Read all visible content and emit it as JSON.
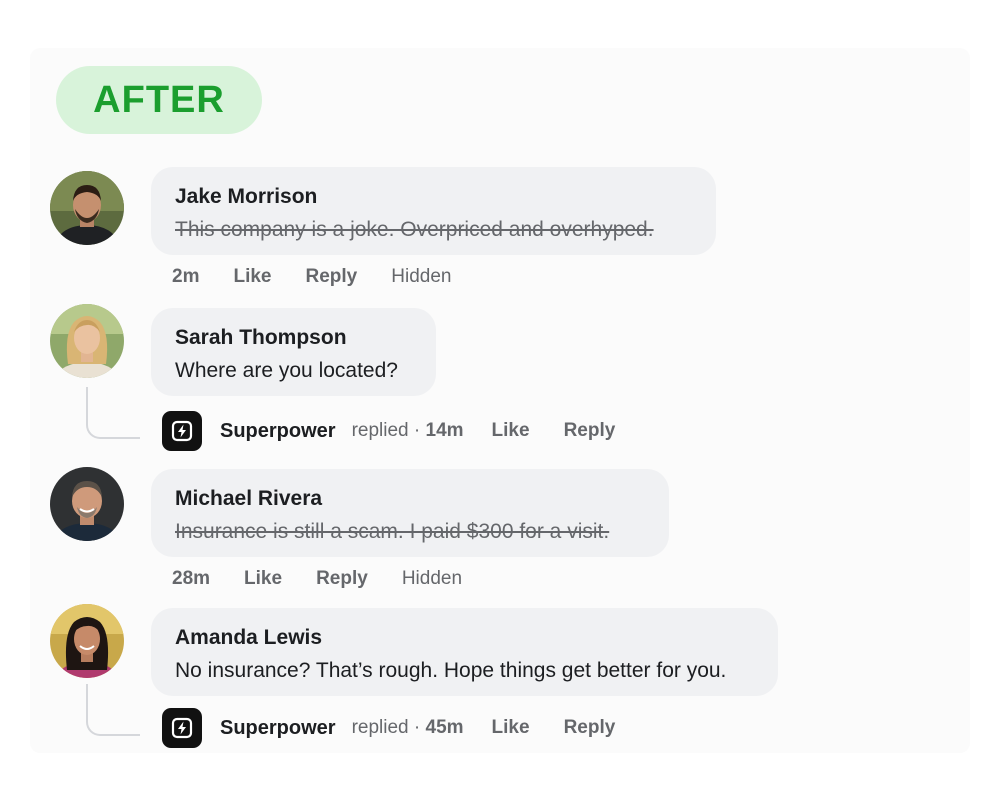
{
  "badge": {
    "label": "AFTER",
    "color": "#1b9e2e",
    "background": "#d8f3da"
  },
  "comments": [
    {
      "author": "Jake Morrison",
      "text": "This company is a joke. Overpriced and overhyped.",
      "hidden_text": true,
      "time": "2m",
      "like": "Like",
      "reply": "Reply",
      "status": "Hidden"
    },
    {
      "author": "Sarah Thompson",
      "text": "Where are you located?",
      "hidden_text": false,
      "reply_by": {
        "name": "Superpower",
        "verb": "replied ·",
        "time": "14m",
        "like": "Like",
        "reply": "Reply"
      }
    },
    {
      "author": "Michael Rivera",
      "text": "Insurance is still a scam. I paid $300 for a visit.",
      "hidden_text": true,
      "time": "28m",
      "like": "Like",
      "reply": "Reply",
      "status": "Hidden"
    },
    {
      "author": "Amanda Lewis",
      "text": "No insurance? That’s rough. Hope things get better for you.",
      "hidden_text": false,
      "reply_by": {
        "name": "Superpower",
        "verb": "replied ·",
        "time": "45m",
        "like": "Like",
        "reply": "Reply"
      }
    }
  ],
  "icons": {
    "brand_logo": "lightning-bolt-icon"
  }
}
